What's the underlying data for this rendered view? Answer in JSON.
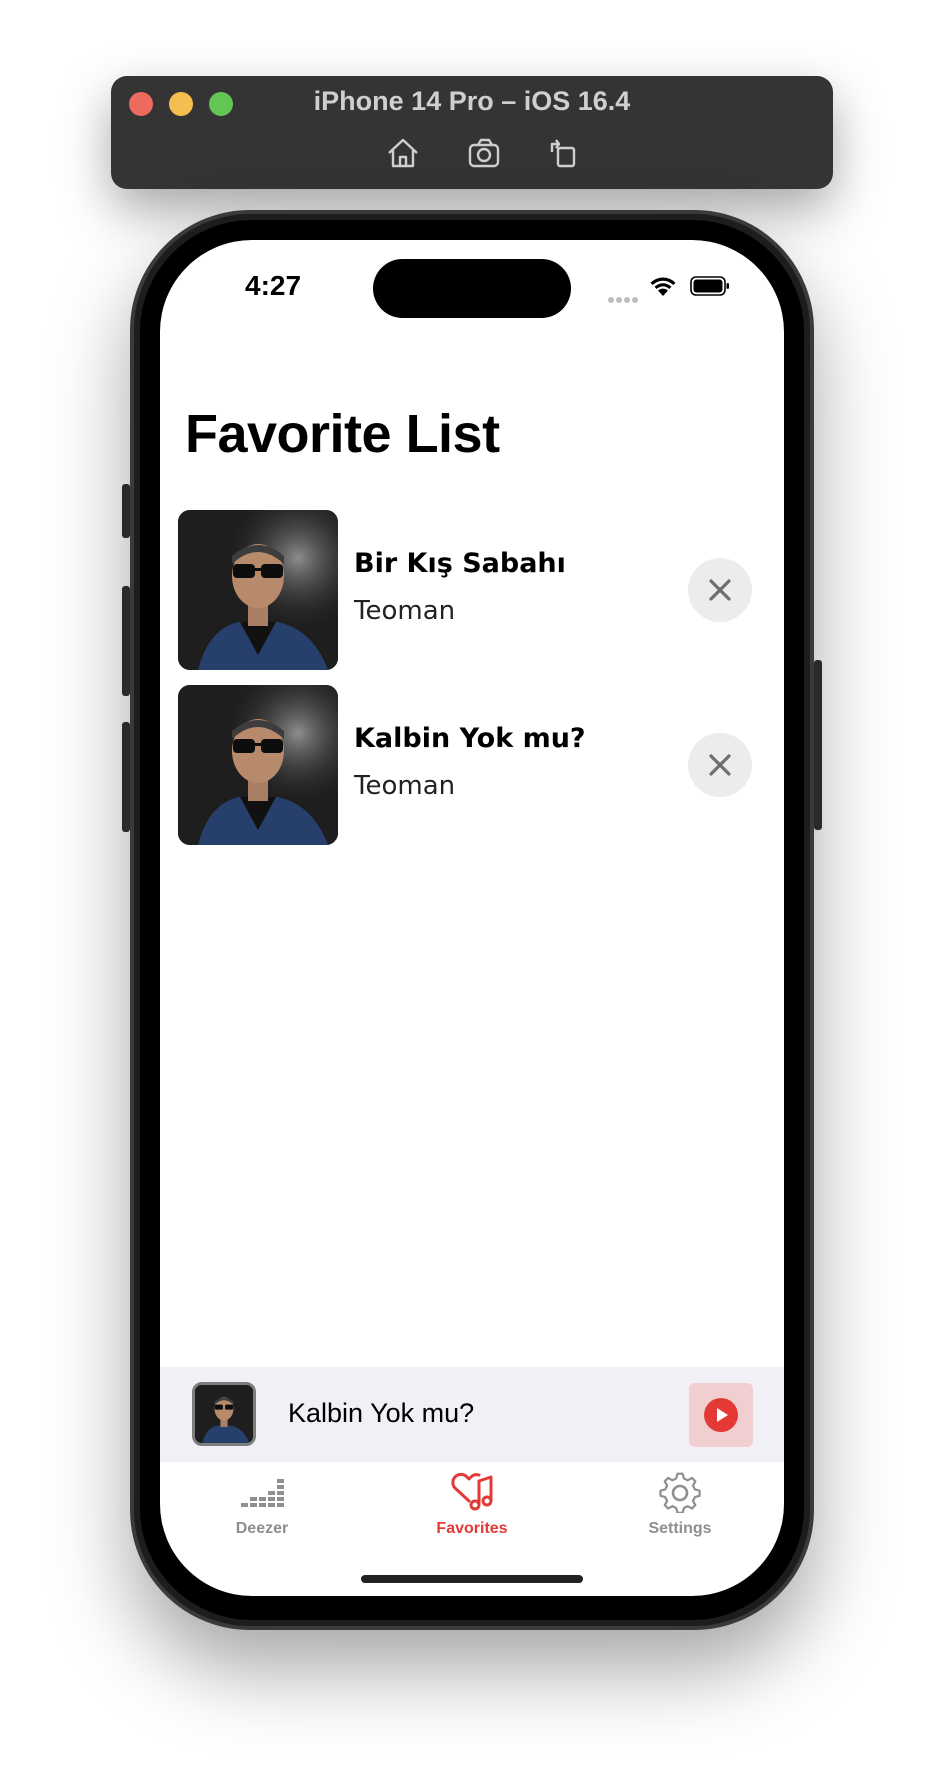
{
  "simulator": {
    "title": "iPhone 14 Pro – iOS 16.4",
    "toolbar": [
      "home-icon",
      "screenshot-icon",
      "rotate-icon"
    ]
  },
  "status_bar": {
    "time": "4:27"
  },
  "page": {
    "title": "Favorite List"
  },
  "favorites": [
    {
      "title": "Bir Kış Sabahı",
      "artist": "Teoman"
    },
    {
      "title": "Kalbin Yok mu?",
      "artist": "Teoman"
    }
  ],
  "mini_player": {
    "title": "Kalbin Yok mu?"
  },
  "tab_bar": {
    "items": [
      {
        "label": "Deezer",
        "icon": "equalizer-icon",
        "active": false
      },
      {
        "label": "Favorites",
        "icon": "heart-music-icon",
        "active": true
      },
      {
        "label": "Settings",
        "icon": "gear-icon",
        "active": false
      }
    ]
  },
  "colors": {
    "accent": "#e53935",
    "inactive": "#8e8e93",
    "mini_player_bg": "#f1f0f6",
    "remove_button_bg": "#ececec"
  }
}
